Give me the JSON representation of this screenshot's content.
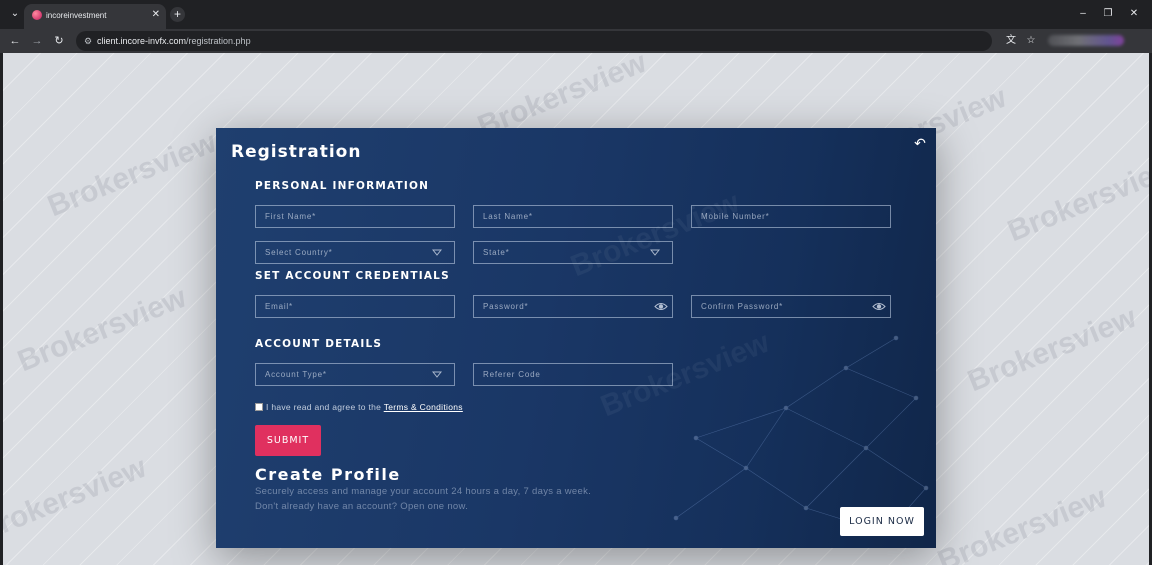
{
  "browser": {
    "tab_title": "incoreinvestment",
    "url_host": "client.incore-invfx.com",
    "url_path": "/registration.php"
  },
  "watermark": "Brokersview",
  "form": {
    "title": "Registration",
    "sections": {
      "personal": "PERSONAL INFORMATION",
      "credentials": "SET ACCOUNT CREDENTIALS",
      "account": "ACCOUNT DETAILS"
    },
    "fields": {
      "first_name": "First Name*",
      "last_name": "Last Name*",
      "mobile": "Mobile Number*",
      "country": "Select Country*",
      "state": "State*",
      "email": "Email*",
      "password": "Password*",
      "confirm_password": "Confirm Password*",
      "account_type": "Account Type*",
      "referer_code": "Referer Code"
    },
    "terms_prefix": "I have read and agree to the",
    "terms_link": "Terms & Conditions",
    "submit_label": "SUBMIT"
  },
  "profile": {
    "title": "Create Profile",
    "line1": "Securely access and manage your account 24 hours a day, 7 days a week.",
    "line2": "Don't already have an account? Open one now.",
    "login_label": "LOGIN NOW"
  },
  "colors": {
    "card_bg": "#1a3766",
    "submit_bg": "#e0305f",
    "page_bg": "#dadde2"
  }
}
